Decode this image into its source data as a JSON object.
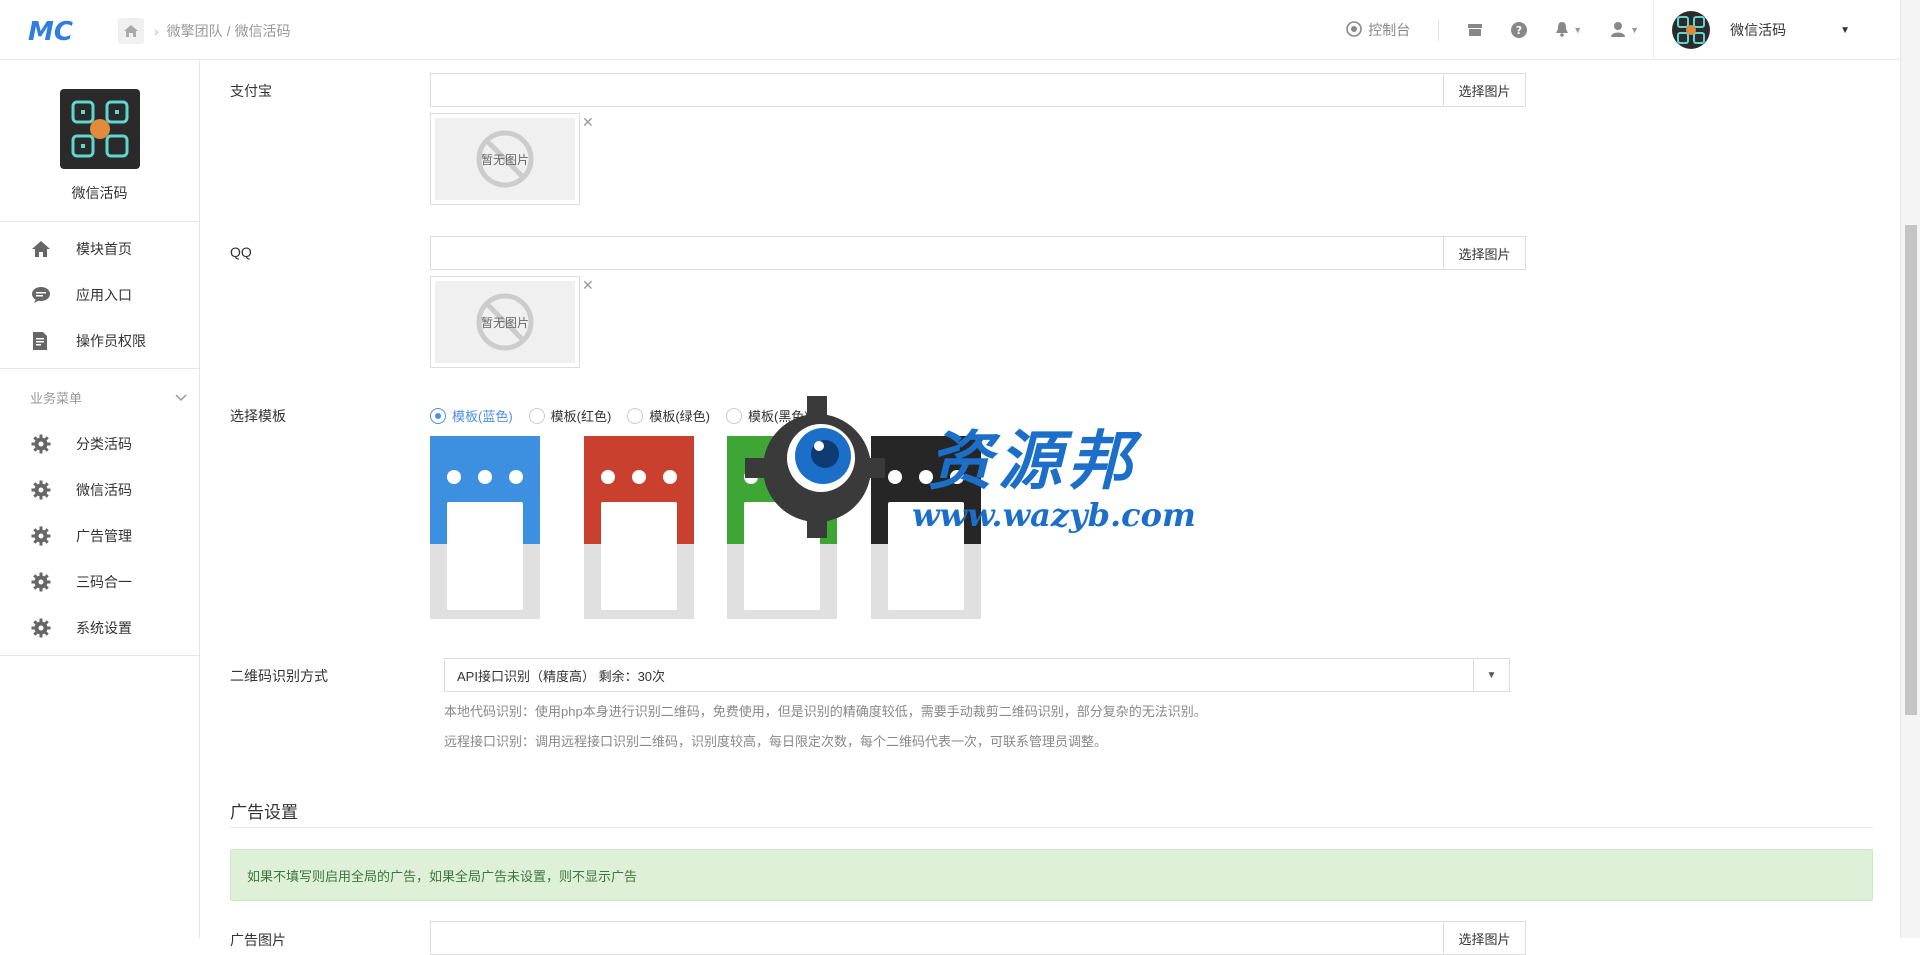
{
  "header": {
    "breadcrumb": [
      "微擎团队",
      "微信活码"
    ],
    "breadcrumb_sep": "/",
    "console_label": "控制台",
    "user_name": "微信活码"
  },
  "sidebar": {
    "app_title": "微信活码",
    "top_items": [
      {
        "label": "模块首页",
        "icon": "home-icon"
      },
      {
        "label": "应用入口",
        "icon": "chat-icon"
      },
      {
        "label": "操作员权限",
        "icon": "edit-doc-icon"
      }
    ],
    "group_title": "业务菜单",
    "group_items": [
      {
        "label": "分类活码",
        "icon": "gear-icon"
      },
      {
        "label": "微信活码",
        "icon": "gear-icon"
      },
      {
        "label": "广告管理",
        "icon": "gear-icon"
      },
      {
        "label": "三码合一",
        "icon": "gear-icon"
      },
      {
        "label": "系统设置",
        "icon": "gear-icon"
      }
    ]
  },
  "form": {
    "alipay_label": "支付宝",
    "qq_label": "QQ",
    "choose_image": "选择图片",
    "no_image": "暂无图片",
    "template_label": "选择模板",
    "templates": [
      {
        "label": "模板(蓝色)",
        "color": "#3d8fe0",
        "selected": true
      },
      {
        "label": "模板(红色)",
        "color": "#c9402e",
        "selected": false
      },
      {
        "label": "模板(绿色)",
        "color": "#3ea635",
        "selected": false
      },
      {
        "label": "模板(黑色)",
        "color": "#262626",
        "selected": false
      }
    ],
    "qr_label": "二维码识别方式",
    "qr_value": "API接口识别（精度高） 剩余：30次",
    "help1": "本地代码识别：使用php本身进行识别二维码，免费使用，但是识别的精确度较低，需要手动裁剪二维码识别，部分复杂的无法识别。",
    "help2": "远程接口识别：调用远程接口识别二维码，识别度较高，每日限定次数，每个二维码代表一次，可联系管理员调整。",
    "ad_section_title": "广告设置",
    "ad_notice": "如果不填写则启用全局的广告，如果全局广告未设置，则不显示广告",
    "ad_image_label": "广告图片"
  },
  "watermark": {
    "title": "资源邦",
    "url": "www.wazyb.com"
  }
}
